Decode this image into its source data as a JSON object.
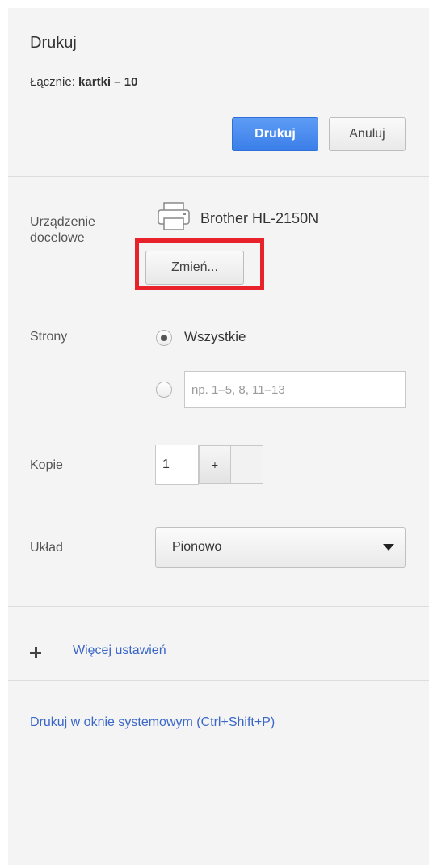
{
  "header": {
    "title": "Drukuj",
    "summary_label": "Łącznie: ",
    "summary_value": "kartki – 10",
    "print_button": "Drukuj",
    "cancel_button": "Anuluj"
  },
  "destination": {
    "label": "Urządzenie docelowe",
    "printer_name": "Brother HL-2150N",
    "change_button": "Zmień...",
    "icon": "printer-icon"
  },
  "pages": {
    "label": "Strony",
    "option_all": "Wszystkie",
    "selected": "all",
    "custom_placeholder": "np. 1–5, 8, 11–13"
  },
  "copies": {
    "label": "Kopie",
    "value": "1",
    "plus": "+",
    "minus": "–"
  },
  "layout": {
    "label": "Układ",
    "value": "Pionowo"
  },
  "more_settings": "Więcej ustawień",
  "system_dialog_link": "Drukuj w oknie systemowym (Ctrl+Shift+P)",
  "colors": {
    "primary_button": "#4a8af0",
    "link": "#3a66c8",
    "highlight_box": "#e8222b",
    "panel_background": "#f4f4f4"
  }
}
